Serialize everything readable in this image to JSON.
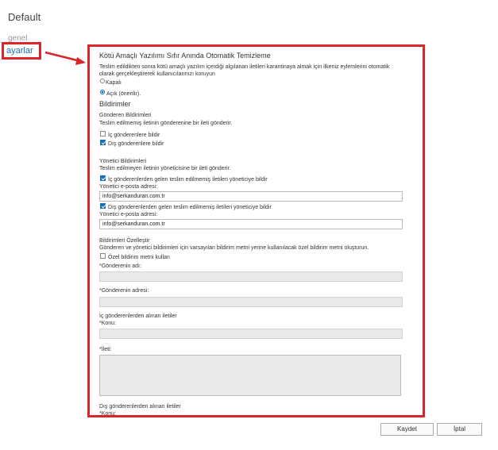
{
  "page": {
    "title": "Default"
  },
  "nav": {
    "genel": "genel",
    "ayarlar": "ayarlar"
  },
  "settings": {
    "heading": "Kötü Amaçlı Yazılımı Sıfır Anında Otomatik Temizleme",
    "desc_line1": "Teslim edildikten sonra kötü amaçlı yazılım içerdiği algılanan iletileri karantinaya almak için ilkeniz eylemlerini otomatik",
    "desc_line2": "olarak gerçekleştirerek kullanıcılarınızı koruyun",
    "option_off": "Kapalı",
    "option_on": "Açık (önerilir).",
    "notifications_heading": "Bildirimler",
    "sender_heading": "Gönderen Bildirimleri",
    "sender_desc": "Teslim edilmemiş iletinin gönderenine bir ileti gönderir.",
    "notify_internal": "İç gönderenlere bildir",
    "notify_external": "Dış gönderenlere bildir",
    "admin_heading": "Yönetici Bildirimleri",
    "admin_desc": "Teslim edilmeyen iletinin yöneticisine bir ileti gönderir.",
    "admin_internal": "İç gönderenlerden gelen teslim edilmemiş iletileri yöneticiye bildir",
    "admin_email_label_1": "Yönetici e-posta adresi:",
    "admin_email_value_1": "info@serkanduran.com.tr",
    "admin_external": "Dış gönderenlerden gelen teslim edilmemiş iletileri yöneticiye bildir",
    "admin_email_label_2": "Yönetici e-posta adresi:",
    "admin_email_value_2": "info@serkanduran.com.tr",
    "customize_heading": "Bildirimleri Özelleştir",
    "customize_desc": "Gönderen ve yönetici bildirimleri için varsayılan bildirim metni yerine kullanılacak özel bildirim metni oluşturun.",
    "use_custom": "Özel bildirim metni kullan",
    "sender_name_label": "*Gönderenin adı:",
    "sender_address_label": "*Gönderenin adresi:",
    "internal_messages_heading": "İç gönderenlerden alınan iletiler",
    "subject_label_1": "*Konu:",
    "message_label": "*İleti:",
    "external_messages_heading": "Dış gönderenlerden alınan iletiler",
    "subject_label_2": "*Konu:"
  },
  "footer": {
    "save": "Kaydet",
    "cancel": "İptal"
  },
  "colors": {
    "highlight": "#d9262b",
    "accent": "#1a6fb5"
  }
}
